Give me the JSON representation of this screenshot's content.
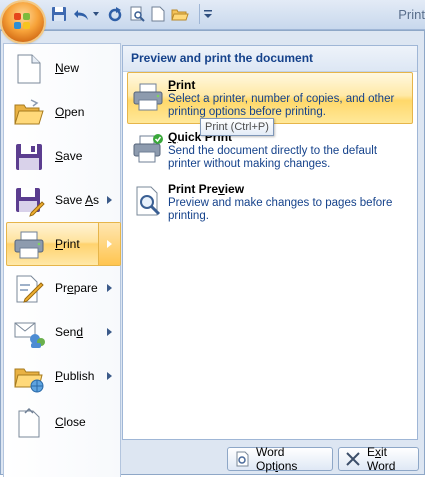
{
  "window": {
    "title_fragment": "Print"
  },
  "quick_access": {
    "icons": [
      "save-icon",
      "undo-icon",
      "undo-dropdown-icon",
      "redo-icon",
      "print-preview-icon",
      "new-document-icon",
      "open-icon",
      "customize-dropdown-icon"
    ]
  },
  "office_button": {
    "icon": "office-logo-icon"
  },
  "menu": {
    "items": [
      {
        "label": "New",
        "underline": "N",
        "rest": "ew",
        "icon": "new-document-icon",
        "has_submenu": false
      },
      {
        "label": "Open",
        "underline": "O",
        "rest": "pen",
        "icon": "open-folder-icon",
        "has_submenu": false
      },
      {
        "label": "Save",
        "underline": "S",
        "rest": "ave",
        "icon": "save-disk-icon",
        "has_submenu": false
      },
      {
        "label": "Save As",
        "pre": "Save ",
        "underline": "A",
        "rest": "s",
        "icon": "save-as-icon",
        "has_submenu": true
      },
      {
        "label": "Print",
        "underline": "P",
        "rest": "rint",
        "icon": "printer-icon",
        "has_submenu": true,
        "active": true
      },
      {
        "label": "Prepare",
        "pre": "Pr",
        "underline": "e",
        "rest": "pare",
        "icon": "prepare-icon",
        "has_submenu": true
      },
      {
        "label": "Send",
        "pre": "Sen",
        "underline": "d",
        "rest": "",
        "icon": "send-icon",
        "has_submenu": true
      },
      {
        "label": "Publish",
        "underline": "P",
        "rest": "ublish",
        "pre": "",
        "icon": "publish-icon",
        "has_submenu": true
      },
      {
        "label": "Close",
        "underline": "C",
        "rest": "lose",
        "icon": "close-document-icon",
        "has_submenu": false
      }
    ]
  },
  "submenu": {
    "header": "Preview and print the document",
    "entries": [
      {
        "title_u": "P",
        "title_rest": "rint",
        "description": "Select a printer, number of copies, and other printing options before printing.",
        "icon": "printer-icon",
        "active": true
      },
      {
        "title_u": "Q",
        "title_rest": "uick Print",
        "description": "Send the document directly to the default printer without making changes.",
        "icon": "quick-print-icon",
        "active": false
      },
      {
        "title_pre": "Print Pre",
        "title_u": "v",
        "title_rest": "iew",
        "description": "Preview and make changes to pages before printing.",
        "icon": "print-preview-icon",
        "active": false
      }
    ],
    "tooltip": "Print (Ctrl+P)"
  },
  "footer": {
    "options_pre": "Word Opt",
    "options_u": "i",
    "options_rest": "ons",
    "exit_pre": "E",
    "exit_u": "x",
    "exit_rest": "it Word",
    "options_icon": "options-icon",
    "exit_icon": "exit-icon"
  },
  "colors": {
    "accent": "#ffd26e",
    "frame": "#dde6f2",
    "text_blue": "#15428b"
  }
}
